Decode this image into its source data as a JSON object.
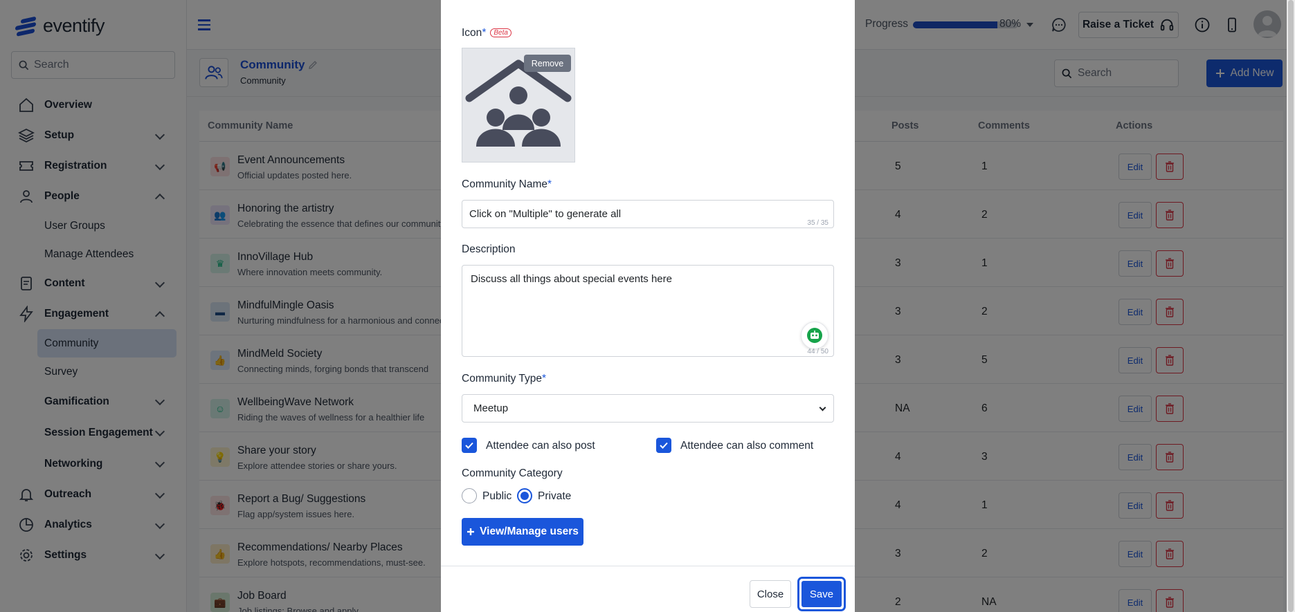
{
  "brand": {
    "name": "eventify"
  },
  "sidebar": {
    "search_placeholder": "Search",
    "items": [
      {
        "label": "Overview"
      },
      {
        "label": "Setup"
      },
      {
        "label": "Registration"
      },
      {
        "label": "People",
        "children": [
          "User Groups",
          "Manage Attendees"
        ]
      },
      {
        "label": "Content"
      },
      {
        "label": "Engagement",
        "children": [
          "Community",
          "Survey",
          "Gamification",
          "Session Engagement",
          "Networking"
        ]
      },
      {
        "label": "Outreach"
      },
      {
        "label": "Analytics"
      },
      {
        "label": "Settings"
      }
    ]
  },
  "header": {
    "progress_label": "Progress",
    "progress_value": 80,
    "progress_text": "80%",
    "ticket_label": "Raise a Ticket"
  },
  "page": {
    "title": "Community",
    "subtitle": "Community",
    "search_placeholder": "Search",
    "add_new_label": "Add New"
  },
  "table": {
    "columns": {
      "name": "Community Name",
      "posts": "Posts",
      "comments": "Comments",
      "actions": "Actions"
    },
    "edit_label": "Edit",
    "rows": [
      {
        "name": "Event Announcements",
        "desc": "Official updates posted here.",
        "posts": "5",
        "comments": "1",
        "icon": "megaphone-icon",
        "color": "#fde2e4",
        "fg": "#e11d48"
      },
      {
        "name": "Honoring the artistry",
        "desc": "Celebrating the essence that defines our community",
        "posts": "4",
        "comments": "2",
        "icon": "people-icon",
        "color": "#ede4fb",
        "fg": "#7c3aed"
      },
      {
        "name": "InnoVillage Hub",
        "desc": "Where innovation meets community.",
        "posts": "3",
        "comments": "1",
        "icon": "crown-icon",
        "color": "#d7f4ea",
        "fg": "#10b981"
      },
      {
        "name": "MindfulMingle Oasis",
        "desc": "Nurturing mindfulness for a harmonious and connec",
        "posts": "3",
        "comments": "2",
        "icon": "chat-icon",
        "color": "#d9e6f5",
        "fg": "#1e4f8a"
      },
      {
        "name": "MindMeld Society",
        "desc": "Connecting minds, forging bonds that transcend",
        "posts": "3",
        "comments": "5",
        "icon": "thumbs-up-icon",
        "color": "#dbe8fb",
        "fg": "#2563eb"
      },
      {
        "name": "WellbeingWave Network",
        "desc": "Riding the waves of wellness for a healthier life",
        "posts": "NA",
        "comments": "6",
        "icon": "smile-icon",
        "color": "#d4f3ea",
        "fg": "#10b981"
      },
      {
        "name": "Share your story",
        "desc": "Explore attendee stories or share yours.",
        "posts": "4",
        "comments": "3",
        "icon": "bulb-icon",
        "color": "#fdf3cf",
        "fg": "#eab308"
      },
      {
        "name": "Report a Bug/ Suggestions",
        "desc": "Flag app/system issues here.",
        "posts": "4",
        "comments": "1",
        "icon": "bug-icon",
        "color": "#fde4e4",
        "fg": "#b91c1c"
      },
      {
        "name": "Recommendations/ Nearby Places",
        "desc": "Explore hotspots, recommendations, must-see.",
        "posts": "3",
        "comments": "2",
        "icon": "thumbs-up-icon",
        "color": "#fdecc8",
        "fg": "#d97706"
      },
      {
        "name": "Job Board",
        "desc": "Job listings: Browse and apply.",
        "posts": "2",
        "comments": "NA",
        "icon": "briefcase-icon",
        "color": "#d5efd9",
        "fg": "#7c2d12"
      }
    ]
  },
  "modal": {
    "icon_label": "Icon",
    "beta_label": "Beta",
    "remove_label": "Remove",
    "name_label": "Community Name",
    "name_value": "Click on \"Multiple\" to generate all",
    "name_counter": "35 / 35",
    "description_label": "Description",
    "description_value": "Discuss all things about special events here",
    "description_counter": "44 / 50",
    "type_label": "Community Type",
    "type_value": "Meetup",
    "post_checkbox_label": "Attendee can also post",
    "comment_checkbox_label": "Attendee can also comment",
    "category_label": "Community Category",
    "category_public": "Public",
    "category_private": "Private",
    "manage_users_label": "View/Manage users",
    "close_label": "Close",
    "save_label": "Save"
  }
}
